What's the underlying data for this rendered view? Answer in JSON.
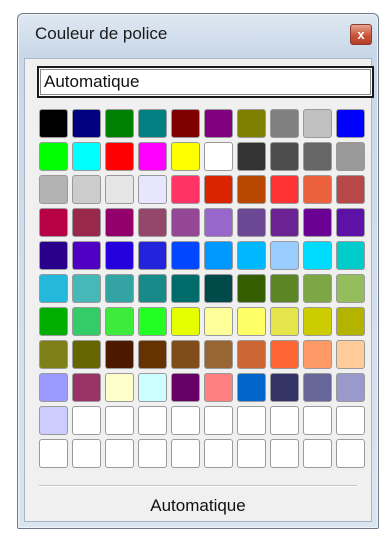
{
  "window": {
    "title": "Couleur de police",
    "close_label": "x"
  },
  "automatic_top": "Automatique",
  "automatic_bottom": "Automatique",
  "palette": [
    "#000000",
    "#000080",
    "#008000",
    "#008080",
    "#800000",
    "#800080",
    "#808000",
    "#808080",
    "#c0c0c0",
    "#0000ff",
    "#00ff00",
    "#00ffff",
    "#ff0000",
    "#ff00ff",
    "#ffff00",
    "#ffffff",
    "#333333",
    "#4d4d4d",
    "#666666",
    "#999999",
    "#b3b3b3",
    "#cccccc",
    "#e6e6e6",
    "#e6e6ff",
    "#ff3366",
    "#dc2300",
    "#b84700",
    "#ff3333",
    "#eb613d",
    "#b84747",
    "#b80047",
    "#99284c",
    "#94006b",
    "#94476b",
    "#944794",
    "#9966cc",
    "#6b4794",
    "#6b2394",
    "#6b0094",
    "#5e11a6",
    "#28008a",
    "#4f00c2",
    "#2300dc",
    "#2323dc",
    "#0047ff",
    "#0099ff",
    "#00b8ff",
    "#99ccff",
    "#00dcff",
    "#00cccc",
    "#23b8dc",
    "#47b8b8",
    "#33a3a3",
    "#198a8a",
    "#006b6b",
    "#004a4a",
    "#355e00",
    "#5c8526",
    "#7da647",
    "#94bd5e",
    "#00ae00",
    "#33cc66",
    "#3deb3d",
    "#23ff23",
    "#e6ff00",
    "#ffff99",
    "#ffff66",
    "#e6e64c",
    "#cccc00",
    "#b3b300",
    "#808019",
    "#666600",
    "#4c1900",
    "#663300",
    "#804c19",
    "#996633",
    "#cc6633",
    "#ff6633",
    "#ff9966",
    "#ffcc99",
    "#9999ff",
    "#993366",
    "#ffffcc",
    "#ccffff",
    "#660066",
    "#ff8080",
    "#0066cc",
    "#333366",
    "#666699",
    "#9999cc",
    "#ccccff",
    "#ffffff",
    "#ffffff",
    "#ffffff",
    "#ffffff",
    "#ffffff",
    "#ffffff",
    "#ffffff",
    "#ffffff",
    "#ffffff",
    "#ffffff",
    "#ffffff",
    "#ffffff",
    "#ffffff",
    "#ffffff",
    "#ffffff",
    "#ffffff",
    "#ffffff",
    "#ffffff",
    "#ffffff"
  ]
}
